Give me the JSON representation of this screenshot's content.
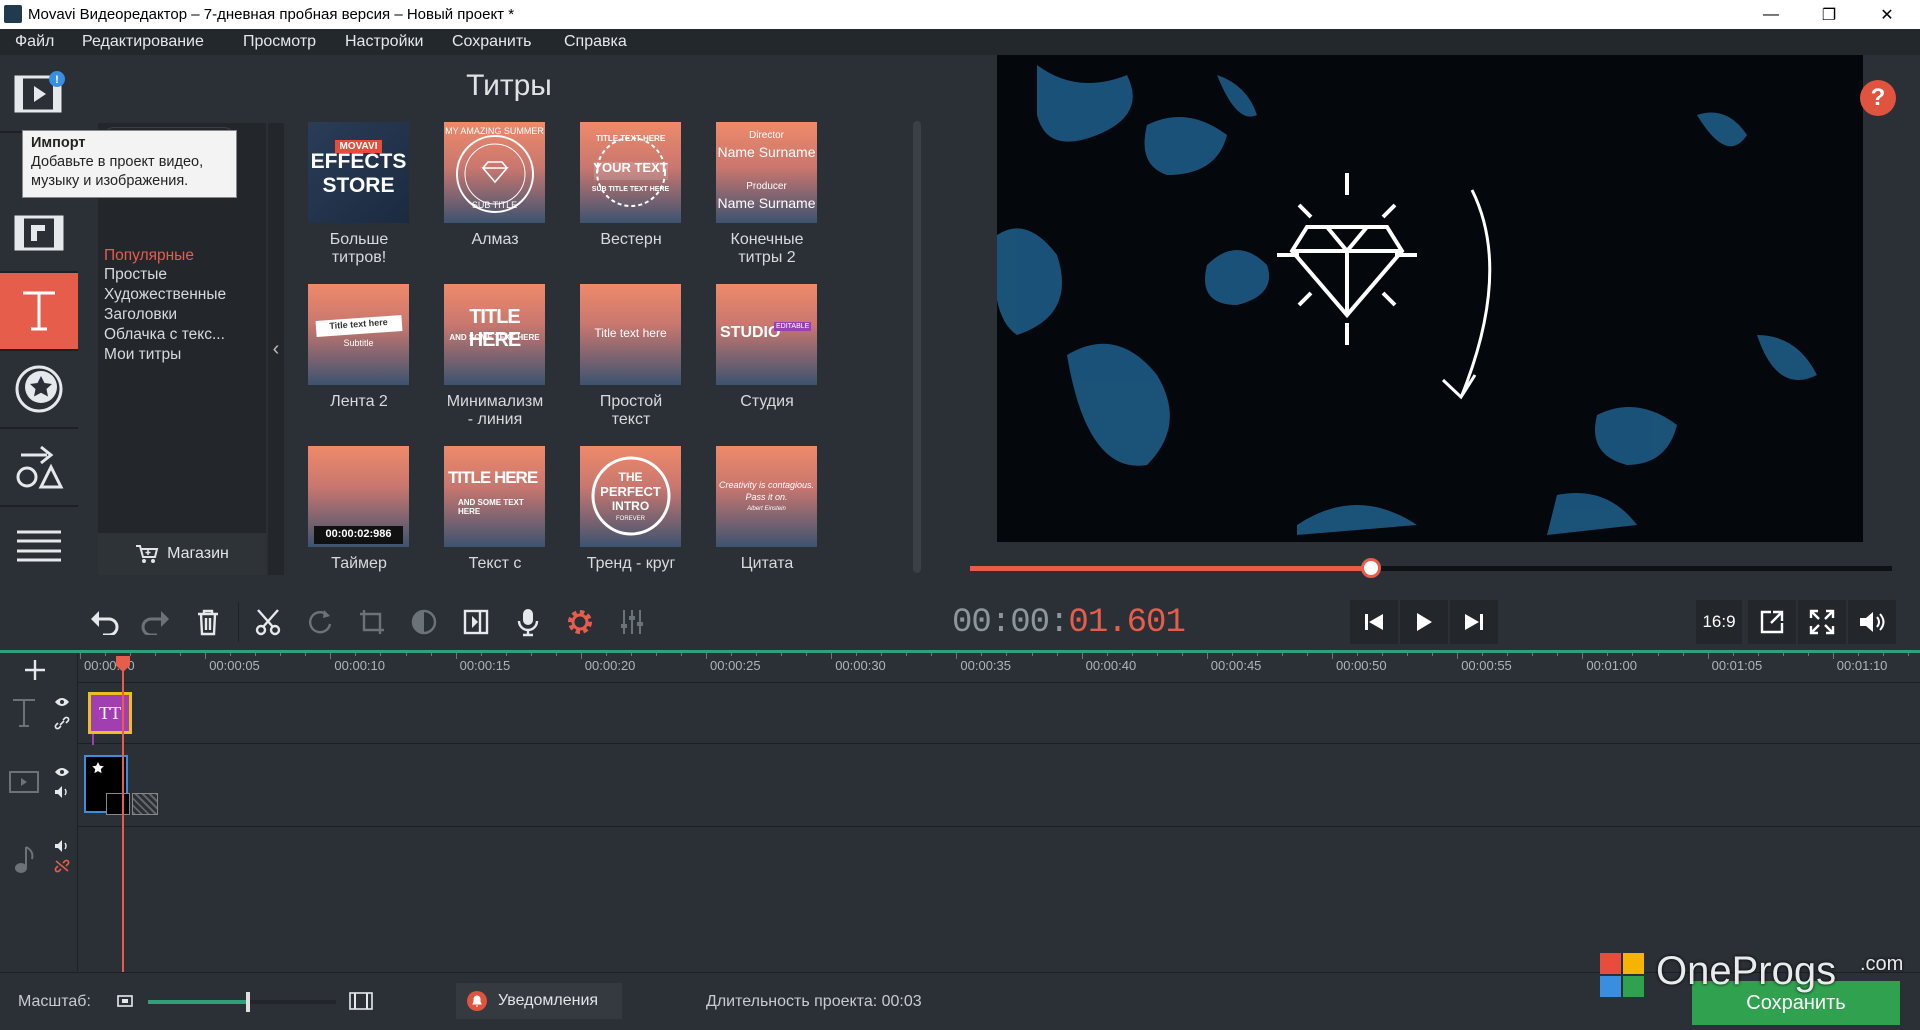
{
  "window": {
    "title": "Movavi Видеоредактор – 7-дневная пробная версия – Новый проект *"
  },
  "menu": [
    "Файл",
    "Редактирование",
    "Просмотр",
    "Настройки",
    "Сохранить",
    "Справка"
  ],
  "tooltip": {
    "title": "Импорт",
    "line1": "Добавьте в проект видео,",
    "line2": "музыку и изображения."
  },
  "panel": {
    "title": "Титры",
    "categories": [
      "Популярные",
      "Простые",
      "Художественные",
      "Заголовки",
      "Облачка с текс...",
      "Мои титры"
    ],
    "store_label": "Магазин",
    "thumbnails": [
      {
        "caption": "Больше титров!",
        "caption_l1": "Больше",
        "caption_l2": "титров!",
        "t1": "MOVAVI",
        "t2": "EFFECTS",
        "t3": "STORE"
      },
      {
        "caption": "Алмаз",
        "t1": "MY AMAZING SUMMER",
        "t2": "SUB TITLE"
      },
      {
        "caption": "Вестерн",
        "t1": "TITLE TEXT HERE",
        "t2": "YOUR TEXT",
        "t3": "SUB TITLE TEXT HERE"
      },
      {
        "caption_l1": "Конечные",
        "caption_l2": "титры 2",
        "t1": "Director",
        "t2": "Name Surname",
        "t3": "Producer",
        "t4": "Name Surname"
      },
      {
        "caption": "Лента 2",
        "t1": "Title text here",
        "t2": "Subtitle"
      },
      {
        "caption_l1": "Минимализм",
        "caption_l2": "- линия",
        "t1": "TITLE HERE",
        "t2": "AND SOME TEXT HERE"
      },
      {
        "caption_l1": "Простой",
        "caption_l2": "текст",
        "t1": "Title text here"
      },
      {
        "caption": "Студия",
        "t1": "STUDIO",
        "t2": "EDITABLE"
      },
      {
        "caption": "Таймер",
        "t1": "00:00:02:986"
      },
      {
        "caption": "Текст с",
        "t1": "TITLE HERE",
        "t2": "AND SOME TEXT HERE"
      },
      {
        "caption": "Тренд - круг",
        "t1": "THE",
        "t2": "PERFECT",
        "t3": "INTRO",
        "t4": "FOREVER"
      },
      {
        "caption": "Цитата",
        "t1": "Creativity is contagious.",
        "t2": "Pass it on.",
        "t3": "Albert Einstein"
      }
    ]
  },
  "player": {
    "timecode_gray": "00:00:",
    "timecode_red": "01.601",
    "progress": 0.435,
    "aspect": "16:9"
  },
  "timeline": {
    "ticks": [
      "00:00:00",
      "00:00:05",
      "00:00:10",
      "00:00:15",
      "00:00:20",
      "00:00:25",
      "00:00:30",
      "00:00:35",
      "00:00:40",
      "00:00:45",
      "00:00:50",
      "00:00:55",
      "00:01:00",
      "00:01:05",
      "00:01:10"
    ],
    "title_clip_label": "TT"
  },
  "status": {
    "scale_label": "Масштаб:",
    "zoom": 0.52,
    "notifications": "Уведомления",
    "duration": "Длительность проекта:  00:03",
    "save": "Сохранить"
  },
  "watermark": {
    "brand": "OneProgs",
    "tld": ".com"
  },
  "colors": {
    "accent": "#e65d4c",
    "green": "#2fa07a",
    "save": "#2fa14f"
  }
}
